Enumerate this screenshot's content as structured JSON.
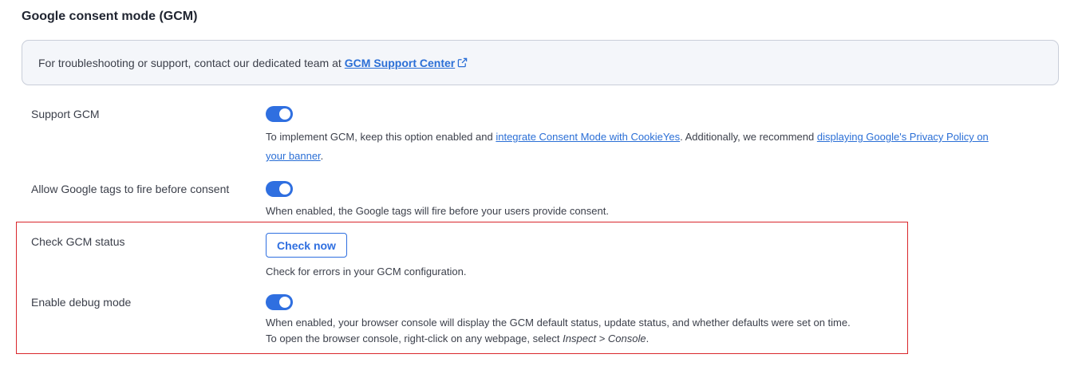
{
  "title": "Google consent mode (GCM)",
  "info": {
    "text": "For troubleshooting or support, contact our dedicated team at",
    "link_label": "GCM Support Center",
    "link_icon": "external-link-icon"
  },
  "settings": {
    "support_gcm": {
      "label": "Support GCM",
      "enabled": true,
      "desc_prefix": "To implement GCM, keep this option enabled and ",
      "link1": "integrate Consent Mode with CookieYes",
      "desc_middle": ". Additionally, we recommend ",
      "link2_line1": "displaying Google's Privacy Policy on",
      "link2_line2": "your banner",
      "desc_suffix": "."
    },
    "allow_tags": {
      "label": "Allow Google tags to fire before consent",
      "enabled": true,
      "desc": "When enabled, the Google tags will fire before your users provide consent."
    },
    "check_status": {
      "label": "Check GCM status",
      "button_label": "Check now",
      "desc": "Check for errors in your GCM configuration."
    },
    "debug_mode": {
      "label": "Enable debug mode",
      "enabled": true,
      "desc_line1": "When enabled, your browser console will display the GCM default status, update status, and whether defaults were set on time.",
      "desc_line2_prefix": "To open the browser console, right-click on any webpage, select ",
      "desc_line2_italic": "Inspect > Console",
      "desc_line2_suffix": "."
    }
  },
  "colors": {
    "accent": "#2f6fe0",
    "link": "#2b6fd6",
    "highlight_border": "#d9262b",
    "info_bg": "#f4f6fa"
  }
}
